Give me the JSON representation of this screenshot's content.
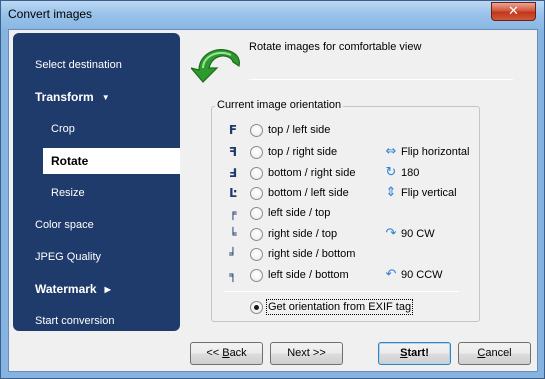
{
  "window": {
    "title": "Convert images",
    "close_glyph": "✕"
  },
  "sidebar": {
    "items": [
      {
        "label": "Select destination",
        "style": "normal"
      },
      {
        "label": "Transform",
        "style": "bold",
        "arrow": "▼"
      },
      {
        "label": "Crop",
        "style": "sub"
      },
      {
        "label": "Rotate",
        "style": "active"
      },
      {
        "label": "Resize",
        "style": "sub"
      },
      {
        "label": "Color space",
        "style": "normal"
      },
      {
        "label": "JPEG Quality",
        "style": "normal"
      },
      {
        "label": "Watermark",
        "style": "bold",
        "arrow": "▶"
      },
      {
        "label": "Start conversion",
        "style": "normal"
      }
    ]
  },
  "header": {
    "title": "Rotate images for comfortable view",
    "icon": "green-rotate-arrow-icon"
  },
  "orientation": {
    "group_title": "Current image orientation",
    "options": [
      {
        "label": "top / left side",
        "glyph": "F",
        "selected": false
      },
      {
        "label": "top / right side",
        "glyph": "ꟻ",
        "selected": false
      },
      {
        "label": "bottom / right side",
        "glyph": "Ⅎ",
        "selected": false
      },
      {
        "label": "bottom / left side",
        "glyph": "Ŀ",
        "selected": false
      },
      {
        "label": "left side / top",
        "glyph": "╒",
        "selected": false
      },
      {
        "label": "right side / top",
        "glyph": "╘",
        "selected": false
      },
      {
        "label": "right side / bottom",
        "glyph": "╛",
        "selected": false
      },
      {
        "label": "left side / bottom",
        "glyph": "╕",
        "selected": false
      }
    ],
    "exif_option": {
      "label": "Get orientation from EXIF tag",
      "selected": true
    }
  },
  "actions": [
    {
      "label": "Flip horizontal",
      "icon": "flip-horizontal-icon",
      "glyph": "⇔"
    },
    {
      "label": "180",
      "icon": "rotate-180-icon",
      "glyph": "↻"
    },
    {
      "label": "Flip vertical",
      "icon": "flip-vertical-icon",
      "glyph": "⇕"
    },
    {
      "label": "90 CW",
      "icon": "rotate-cw-icon",
      "glyph": "↷"
    },
    {
      "label": "90 CCW",
      "icon": "rotate-ccw-icon",
      "glyph": "↶"
    }
  ],
  "buttons": {
    "back": {
      "prefix": "<< ",
      "mnemonic": "B",
      "rest": "ack"
    },
    "next": {
      "label": "Next >>"
    },
    "start": {
      "prefix": "",
      "mnemonic": "S",
      "rest": "tart!"
    },
    "cancel": {
      "prefix": "",
      "mnemonic": "C",
      "rest": "ancel"
    }
  },
  "colors": {
    "sidebar_bg": "#1f3b6b",
    "frame": "#86b3e0",
    "action_icon": "#2f7fd2",
    "arrow_green": "#2e9a2e"
  }
}
